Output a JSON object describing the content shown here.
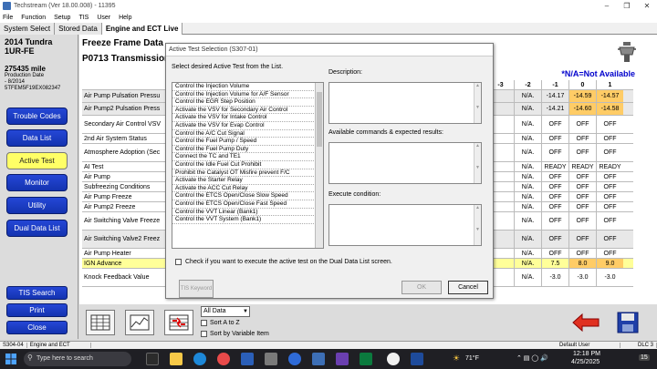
{
  "window": {
    "title": "Techstream (Ver 18.00.008) - 11395"
  },
  "menu": [
    "File",
    "Function",
    "Setup",
    "TIS",
    "User",
    "Help"
  ],
  "tabs": [
    "System Select",
    "Stored Data",
    "Engine and ECT Live"
  ],
  "vehicle": {
    "model": "2014 Tundra",
    "engine": "1UR-FE",
    "mileage": "275435 mile",
    "prod_label": "Production Date",
    "prod_date": "- 8/2014",
    "vin": "5TFEM5F19EX082347"
  },
  "nav": [
    "Trouble Codes",
    "Data List",
    "Active Test",
    "Monitor",
    "Utility",
    "Dual Data List"
  ],
  "left_bottom": [
    "TIS Search",
    "Print",
    "Close"
  ],
  "freeze": {
    "title": "Freeze Frame Data",
    "code": "P0713 Transmission F",
    "na_note": "*N/A=Not Available",
    "headers": [
      "-3",
      "-2",
      "-1",
      "0",
      "1"
    ]
  },
  "rows": [
    {
      "name": "Air Pump Pulsation Pressu",
      "vals": [
        "",
        "N/A.",
        "-14.17",
        "-14.59",
        "-14.57"
      ],
      "orange": [
        3,
        4
      ]
    },
    {
      "name": "Air Pump2 Pulsation Press",
      "vals": [
        "",
        "N/A.",
        "-14.21",
        "-14.60",
        "-14.58"
      ],
      "orange": [
        3,
        4
      ]
    },
    {
      "name": "Secondary Air Control VSV",
      "vals": [
        "",
        "N/A.",
        "OFF",
        "OFF",
        "OFF"
      ],
      "orange": []
    },
    {
      "name": "2nd Air System Status",
      "vals": [
        "",
        "N/A.",
        "OFF",
        "OFF",
        "OFF"
      ],
      "orange": []
    },
    {
      "name": "Atmosphere Adoption (Sec",
      "vals": [
        "",
        "N/A.",
        "OFF",
        "OFF",
        "OFF"
      ],
      "orange": []
    },
    {
      "name": "AI Test",
      "vals": [
        "",
        "N/A.",
        "READY",
        "READY",
        "READY"
      ],
      "orange": []
    },
    {
      "name": "Air Pump",
      "vals": [
        "",
        "N/A.",
        "OFF",
        "OFF",
        "OFF"
      ],
      "orange": []
    },
    {
      "name": "Subfreezing Conditions",
      "vals": [
        "",
        "N/A.",
        "OFF",
        "OFF",
        "OFF"
      ],
      "orange": []
    },
    {
      "name": "Air Pump Freeze",
      "vals": [
        "",
        "N/A.",
        "OFF",
        "OFF",
        "OFF"
      ],
      "orange": []
    },
    {
      "name": "Air Pump2 Freeze",
      "vals": [
        "",
        "N/A.",
        "OFF",
        "OFF",
        "OFF"
      ],
      "orange": []
    },
    {
      "name": "Air Switching Valve Freeze",
      "vals": [
        "",
        "N/A.",
        "OFF",
        "OFF",
        "OFF"
      ],
      "orange": []
    },
    {
      "name": "Air Switching Valve2 Freez",
      "vals": [
        "",
        "N/A.",
        "OFF",
        "OFF",
        "OFF"
      ],
      "orange": []
    },
    {
      "name": "Air Pump Heater",
      "vals": [
        "",
        "N/A.",
        "OFF",
        "OFF",
        "OFF"
      ],
      "orange": []
    },
    {
      "name": "IGN Advance",
      "vals": [
        "",
        "N/A.",
        "7.5",
        "8.0",
        "9.0"
      ],
      "orange": [
        3,
        4
      ]
    },
    {
      "name": "Knock Feedback Value",
      "vals": [
        "",
        "N/A.",
        "-3.0",
        "-3.0",
        "-3.0"
      ],
      "orange": []
    }
  ],
  "dialog": {
    "title": "Active Test Selection (S307-01)",
    "prompt": "Select desired Active Test from the List.",
    "description_label": "Description:",
    "commands_label": "Available commands & expected results:",
    "execute_label": "Execute condition:",
    "checkbox_label": "Check if you want to execute the active test on the Dual Data List screen.",
    "tis_label": "TIS Keyword",
    "ok": "OK",
    "cancel": "Cancel",
    "items": [
      "Control the Injection Volume",
      "Control the Injection Volume for A/F Sensor",
      "Control the EGR Step Position",
      "Activate the VSV for Secondary Air Control",
      "Activate the VSV for Intake Control",
      "Activate the VSV for Evap Control",
      "Control the A/C Cut Signal",
      "Control the Fuel Pump / Speed",
      "Control the Fuel Pump Duty",
      "Connect the TC and TE1",
      "Control the Idle Fuel Cut Prohibit",
      "Prohibit the Catalyst OT Misfire prevent F/C",
      "Activate the Starter Relay",
      "Activate the ACC Cut Relay",
      "Control the ETCS Open/Close Slow Speed",
      "Control the ETCS Open/Close Fast Speed",
      "Control the VVT Linear (Bank1)",
      "Control the VVT System (Bank1)"
    ]
  },
  "toolbar": {
    "select_value": "All Data",
    "sort_az": "Sort A to Z",
    "sort_var": "Sort by Variable Item"
  },
  "statusbar": {
    "code": "S304-04",
    "system": "Engine and ECT",
    "user": "Default User",
    "dlc": "DLC 3"
  },
  "taskbar": {
    "search": "Type here to search",
    "weather": "71°F",
    "time": "12:18 PM",
    "date": "4/25/2025",
    "notif": "15"
  }
}
